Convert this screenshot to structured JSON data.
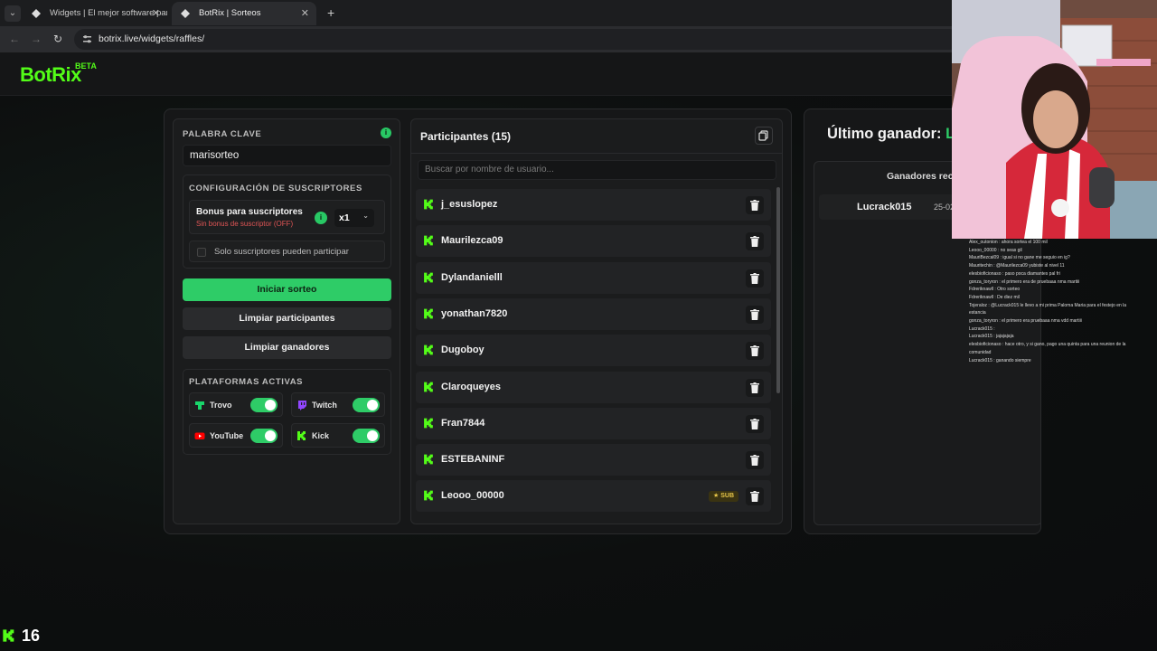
{
  "browser": {
    "tabs": [
      {
        "title": "Widgets | El mejor software para",
        "active": false
      },
      {
        "title": "BotRix | Sorteos",
        "active": true
      }
    ],
    "url": "botrix.live/widgets/raffles/"
  },
  "app": {
    "logo": "BotRix",
    "badge": "BETA"
  },
  "config": {
    "keyword_label": "PALABRA CLAVE",
    "keyword_value": "marisorteo",
    "subs_section_label": "CONFIGURACIÓN DE SUSCRIPTORES",
    "bonus_title": "Bonus para suscriptores",
    "bonus_subtitle": "Sin bonus de suscriptor (OFF)",
    "multiplier": "x1",
    "only_subs_label": "Solo suscriptores pueden participar",
    "start_button": "Iniciar sorteo",
    "clear_participants_button": "Limpiar participantes",
    "clear_winners_button": "Limpiar ganadores",
    "platforms_label": "PLATAFORMAS ACTIVAS",
    "platforms": [
      {
        "name": "Trovo",
        "enabled": true,
        "color": "#19d66b"
      },
      {
        "name": "Twitch",
        "enabled": true,
        "color": "#9146ff"
      },
      {
        "name": "YouTube",
        "enabled": true,
        "color": "#ff0000"
      },
      {
        "name": "Kick",
        "enabled": true,
        "color": "#53fc18"
      }
    ]
  },
  "participants": {
    "title": "Participantes (15)",
    "search_placeholder": "Buscar por nombre de usuario...",
    "list": [
      {
        "name": "j_esuslopez",
        "sub": false
      },
      {
        "name": "Maurilezca09",
        "sub": false
      },
      {
        "name": "Dylandanielll",
        "sub": false
      },
      {
        "name": "yonathan7820",
        "sub": false
      },
      {
        "name": "Dugoboy",
        "sub": false
      },
      {
        "name": "Claroqueyes",
        "sub": false
      },
      {
        "name": "Fran7844",
        "sub": false
      },
      {
        "name": "ESTEBANINF",
        "sub": false
      },
      {
        "name": "Leooo_00000",
        "sub": true,
        "badge": "SUB"
      }
    ]
  },
  "winner": {
    "title_prefix": "Último ganador: ",
    "name_visible": "Lu",
    "recent_header": "Ganadores recie",
    "recent": [
      {
        "name": "Lucrack015",
        "date": "25-02"
      }
    ]
  },
  "chat": [
    "Alex_outonion : ahora sortea el 100 mil",
    "Leooo_00000 : no seas gil",
    "MauriBezcal09 : igual si no gane me seguio en ig?",
    "Mauritechin : @Maurilezca09 yubiste al nivel 11",
    "elesbioficionaso : paso poca diamantes pal fri",
    "gonza_toryron : el primero era de pruebaaa nma martiii",
    "Fdreriknawll : Otro sorteo",
    "Fdreriknawll : De diez mil",
    "Tojeraloz : @Lucrack015 le llevo a mi prima Paloma Maria para el festejo en la",
    "estancia",
    "gonza_toryron : el primero era pruebaaa nma vdd martiii",
    "Lucrack015 :",
    "Lucrack015 : jajajajaja",
    "elesbioficionaso : hace otro, y si gano, pago una quinta para una reunion de la",
    "comunidad",
    "Lucrack015 : ganando siempre"
  ],
  "stream": {
    "viewer_count": "16",
    "accent": "#53fc18"
  }
}
